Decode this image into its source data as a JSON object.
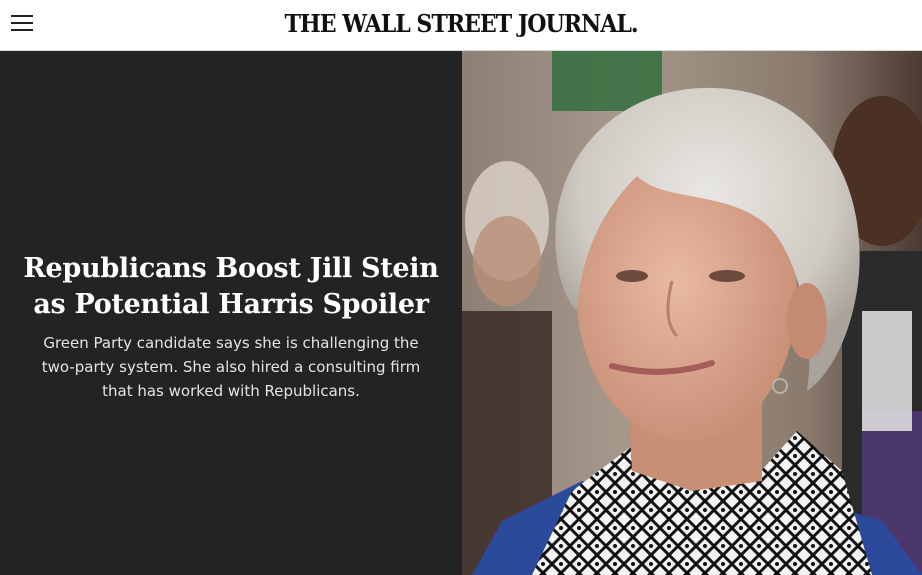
{
  "header": {
    "menu_icon": "hamburger-menu-icon",
    "masthead": "THE WALL STREET JOURNAL."
  },
  "hero": {
    "headline": "Republicans Boost Jill Stein as Potential Harris Spoiler",
    "dek": "Green Party candidate says she is challenging the two-party system. She also hired a consulting firm that has worked with Republicans.",
    "panel_color": "#232323"
  }
}
